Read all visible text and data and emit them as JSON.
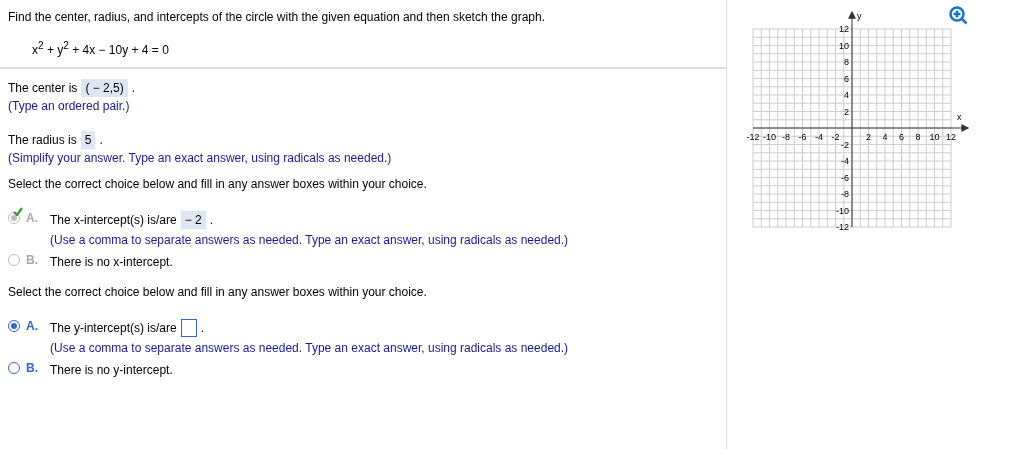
{
  "instruction": "Find the center, radius, and intercepts of the circle with the given equation and then sketch the graph.",
  "equation": "x$^{2}$ + y$^{2}$ + 4x − 10y + 4 = 0",
  "answers": [
    {
      "prefix": "The center is",
      "value": "( − 2,5)",
      "suffix": ".",
      "hint": "(Type an ordered pair.)"
    },
    {
      "prefix": "The radius is",
      "value": "5",
      "suffix": ".",
      "hint": "(Simplify your answer.  Type an exact answer, using radicals as needed.)"
    }
  ],
  "questions": [
    {
      "prompt": "Select the correct choice below and fill in any answer boxes within your choice.",
      "graded": true,
      "choices": [
        {
          "kind": "filled",
          "letter": "A.",
          "text": "The x-intercept(s) is/are",
          "value": "− 2",
          "suffix": ".",
          "hint": "(Use a comma to separate answers as needed. Type an exact answer, using radicals as needed.)",
          "selected": true,
          "correct": true
        },
        {
          "kind": "plain",
          "letter": "B.",
          "text": "There is no x-intercept.",
          "selected": false,
          "correct": false
        }
      ]
    },
    {
      "prompt": "Select the correct choice below and fill in any answer boxes within your choice.",
      "graded": false,
      "choices": [
        {
          "kind": "blank",
          "letter": "A.",
          "text": "The y-intercept(s) is/are",
          "suffix": ".",
          "hint": "(Use a comma to separate answers as needed. Type an exact answer, using radicals as needed.)",
          "selected": true,
          "correct": false
        },
        {
          "kind": "plain",
          "letter": "B.",
          "text": "There is no y-intercept.",
          "selected": false,
          "correct": false
        }
      ]
    }
  ],
  "graph": {
    "x_label": "x",
    "y_label": "y",
    "x_ticks": [
      "-12",
      "-10",
      "-8",
      "-6",
      "-4",
      "-2",
      "2",
      "4",
      "6",
      "8",
      "10",
      "12"
    ],
    "y_ticks": [
      "12",
      "10",
      "8",
      "6",
      "4",
      "2",
      "-2",
      "-4",
      "-6",
      "-8",
      "-10",
      "-12"
    ]
  }
}
